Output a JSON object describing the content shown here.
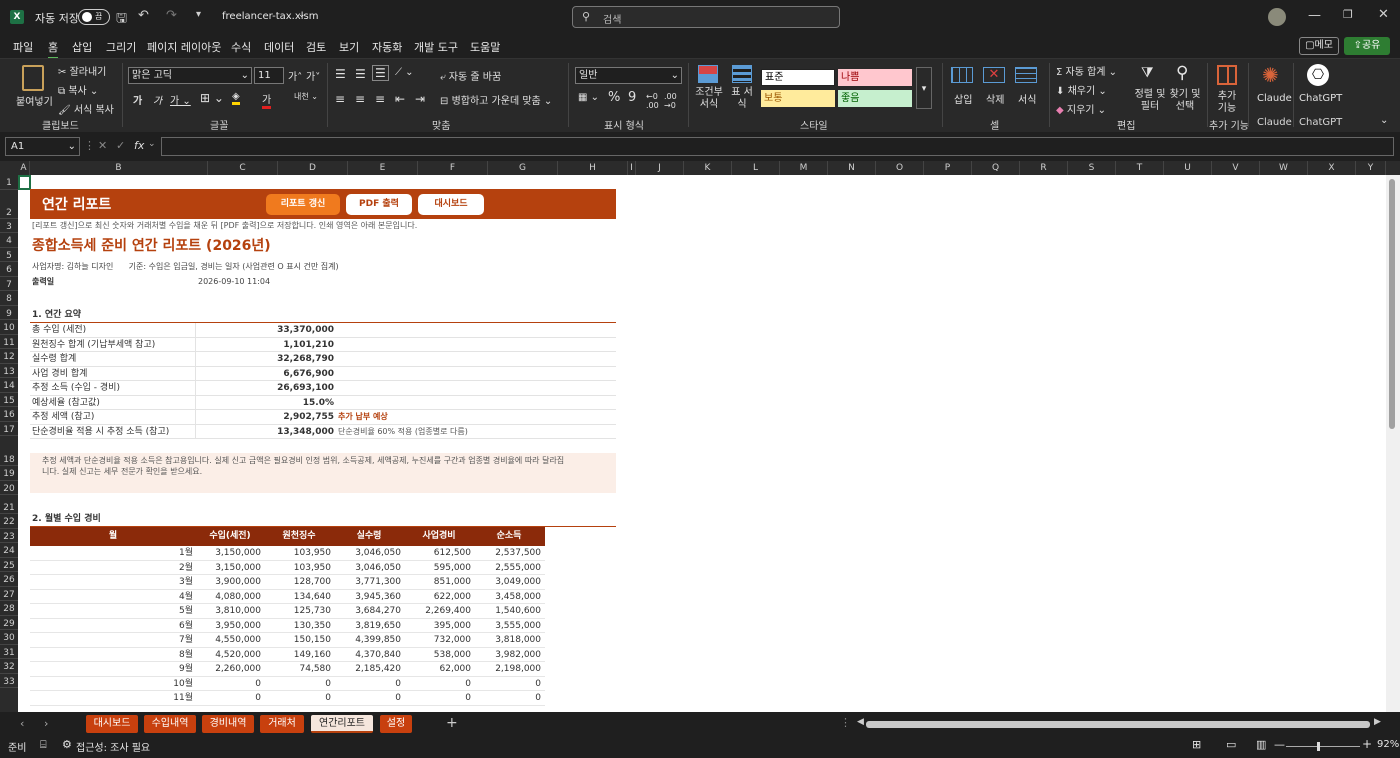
{
  "titlebar": {
    "autosave_label": "자동 저장",
    "autosave_state": "끔",
    "filename": "freelancer-tax.xlsm",
    "search_placeholder": "검색"
  },
  "menu": [
    "파일",
    "홈",
    "삽입",
    "그리기",
    "페이지 레이아웃",
    "수식",
    "데이터",
    "검토",
    "보기",
    "자동화",
    "개발 도구",
    "도움말"
  ],
  "menu_right": {
    "comment": "메모",
    "share": "공유"
  },
  "ribbon": {
    "paste": "붙여넣기",
    "cut": "잘라내기",
    "copy": "복사",
    "format_painter": "서식 복사",
    "clipboard_group": "클립보드",
    "font_name": "맑은 고딕",
    "font_size": "11",
    "font_group": "글꼴",
    "wrap_text": "자동 줄 바꿈",
    "merge_center": "병합하고 가운데 맞춤",
    "align_group": "맞춤",
    "number_format": "일반",
    "number_group": "표시 형식",
    "cond_format": "조건부 서식",
    "table_format": "표 서식",
    "style_normal": "표준",
    "style_bad": "나쁨",
    "style_neutral": "보통",
    "style_good": "좋음",
    "style_group": "스타일",
    "insert": "삽입",
    "delete": "삭제",
    "format": "서식",
    "cells_group": "셀",
    "autosum": "자동 합계",
    "fill": "채우기",
    "clear": "지우기",
    "sort_filter": "정렬 및 필터",
    "find_select": "찾기 및 선택",
    "edit_group": "편집",
    "addins": "추가 기능",
    "addins_group": "추가 기능",
    "claude": "Claude",
    "claude_group": "Claude",
    "chatgpt": "ChatGPT",
    "chatgpt_group": "ChatGPT"
  },
  "formula_bar": {
    "name_box": "A1",
    "fx": "fx",
    "value": ""
  },
  "columns": [
    "A",
    "B",
    "C",
    "D",
    "E",
    "F",
    "G",
    "H",
    "I",
    "J",
    "K",
    "L",
    "M",
    "N",
    "O",
    "P",
    "Q",
    "R",
    "S",
    "T",
    "U",
    "V",
    "W",
    "X",
    "Y"
  ],
  "rows": [
    "1",
    "2",
    "3",
    "4",
    "5",
    "6",
    "7",
    "8",
    "9",
    "10",
    "11",
    "12",
    "13",
    "14",
    "15",
    "16",
    "17",
    "18",
    "19",
    "20",
    "21",
    "22",
    "23",
    "24",
    "25",
    "26",
    "27",
    "28",
    "29",
    "30",
    "31",
    "32",
    "33"
  ],
  "sheet": {
    "banner_title": "연간 리포트",
    "btn_refresh": "리포트 갱신",
    "btn_pdf": "PDF 출력",
    "btn_dashboard": "대시보드",
    "instruction": "[리포트 갱신]으로 최신 숫자와 거래처별 수입을 채운 뒤 [PDF 출력]으로 저장합니다. 인쇄 영역은 아래 본문입니다.",
    "report_title": "종합소득세 준비 연간 리포트 (2026년)",
    "meta": "사업자명: 김하늘 디자인      기준: 수입은 입금일, 경비는 일자 (사업관련 O 표시 건만 집계)",
    "printed_label": "출력일",
    "printed_value": "2026-09-10 11:04",
    "summary_heading": "1. 연간 요약",
    "summary": [
      {
        "label": "총 수입 (세전)",
        "value": "33,370,000",
        "note": ""
      },
      {
        "label": "원천징수 합계 (기납부세액 참고)",
        "value": "1,101,210",
        "note": ""
      },
      {
        "label": "실수령 합계",
        "value": "32,268,790",
        "note": ""
      },
      {
        "label": "사업 경비 합계",
        "value": "6,676,900",
        "note": ""
      },
      {
        "label": "추정 소득 (수입 - 경비)",
        "value": "26,693,100",
        "note": ""
      },
      {
        "label": "예상세율 (참고값)",
        "value": "15.0%",
        "note": ""
      },
      {
        "label": "추정 세액 (참고)",
        "value": "2,902,755",
        "note": "추가 납부 예상"
      },
      {
        "label": "단순경비율 적용 시 추정 소득 (참고)",
        "value": "13,348,000",
        "note": "단순경비율 60% 적용 (업종별로 다름)"
      }
    ],
    "disclaimer_1": "추정 세액과 단순경비율 적용 소득은 참고용입니다. 실제 신고 금액은 필요경비 인정 범위, 소득공제, 세액공제, 누진세를 구간과 업종별 경비율에 따라 달라집",
    "disclaimer_2": "니다. 실제 신고는 세무 전문가 확인을 받으세요.",
    "monthly_heading": "2. 월별 수입 경비",
    "monthly_headers": [
      "월",
      "수입(세전)",
      "원천징수",
      "실수령",
      "사업경비",
      "순소득"
    ],
    "monthly": [
      [
        "1월",
        "3,150,000",
        "103,950",
        "3,046,050",
        "612,500",
        "2,537,500"
      ],
      [
        "2월",
        "3,150,000",
        "103,950",
        "3,046,050",
        "595,000",
        "2,555,000"
      ],
      [
        "3월",
        "3,900,000",
        "128,700",
        "3,771,300",
        "851,000",
        "3,049,000"
      ],
      [
        "4월",
        "4,080,000",
        "134,640",
        "3,945,360",
        "622,000",
        "3,458,000"
      ],
      [
        "5월",
        "3,810,000",
        "125,730",
        "3,684,270",
        "2,269,400",
        "1,540,600"
      ],
      [
        "6월",
        "3,950,000",
        "130,350",
        "3,819,650",
        "395,000",
        "3,555,000"
      ],
      [
        "7월",
        "4,550,000",
        "150,150",
        "4,399,850",
        "732,000",
        "3,818,000"
      ],
      [
        "8월",
        "4,520,000",
        "149,160",
        "4,370,840",
        "538,000",
        "3,982,000"
      ],
      [
        "9월",
        "2,260,000",
        "74,580",
        "2,185,420",
        "62,000",
        "2,198,000"
      ],
      [
        "10월",
        "0",
        "0",
        "0",
        "0",
        "0"
      ],
      [
        "11월",
        "0",
        "0",
        "0",
        "0",
        "0"
      ]
    ]
  },
  "tabs": [
    "대시보드",
    "수입내역",
    "경비내역",
    "거래처",
    "연간리포트",
    "설정"
  ],
  "active_tab": "연간리포트",
  "status": {
    "ready": "준비",
    "accessibility": "접근성: 조사 필요",
    "zoom": "92%"
  },
  "colors": {
    "accent": "#c8400e",
    "excel_green": "#1e7145",
    "share_green": "#2e7d32"
  }
}
